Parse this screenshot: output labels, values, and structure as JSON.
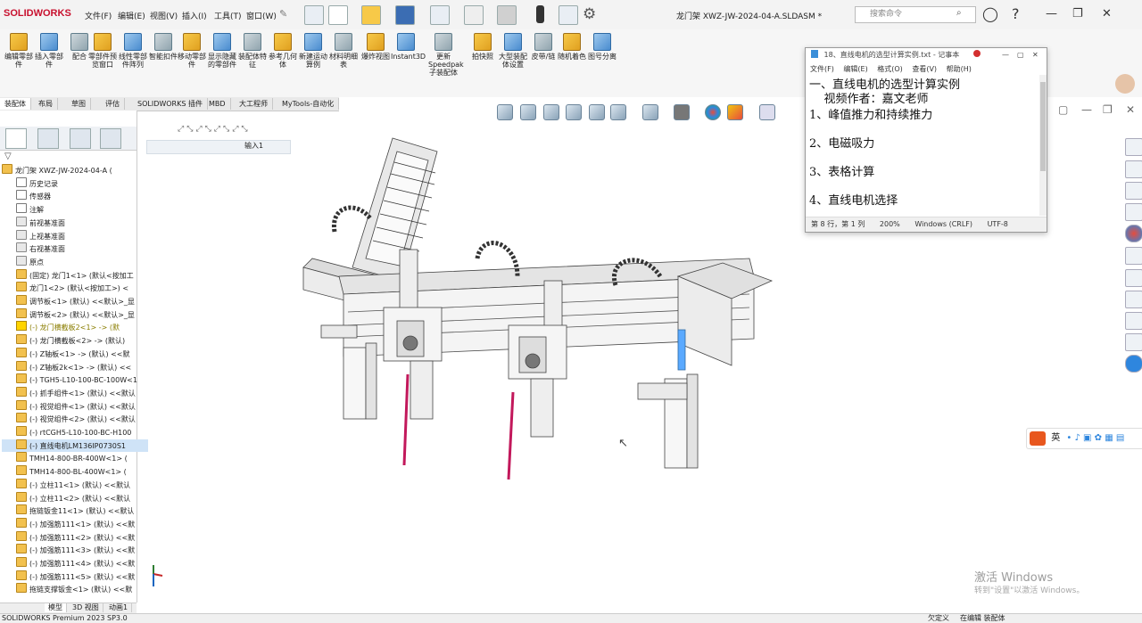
{
  "app": {
    "logo": "SOLIDWORKS",
    "doc_title": "龙门架 XWZ-JW-2024-04-A.SLDASM *",
    "search_placeholder": "搜索命令"
  },
  "menu": [
    "文件(F)",
    "编辑(E)",
    "视图(V)",
    "插入(I)",
    "工具(T)",
    "窗口(W)"
  ],
  "ribbon": [
    {
      "label": "编辑零部件",
      "icon": "edit-component-icon"
    },
    {
      "label": "插入零部件",
      "icon": "insert-component-icon"
    },
    {
      "label": "配合",
      "icon": "mate-icon"
    },
    {
      "label": "零部件预览窗口",
      "icon": "component-preview-icon"
    },
    {
      "label": "线性零部件阵列",
      "icon": "linear-pattern-icon"
    },
    {
      "label": "智能扣件",
      "icon": "smart-fastener-icon"
    },
    {
      "label": "移动零部件",
      "icon": "move-component-icon"
    },
    {
      "label": "显示隐藏的零部件",
      "icon": "show-hidden-icon"
    },
    {
      "label": "装配体特征",
      "icon": "assembly-feature-icon"
    },
    {
      "label": "参考几何体",
      "icon": "reference-geometry-icon"
    },
    {
      "label": "新建运动算例",
      "icon": "motion-study-icon"
    },
    {
      "label": "材料明细表",
      "icon": "bom-icon"
    },
    {
      "label": "爆炸视图",
      "icon": "exploded-view-icon"
    },
    {
      "label": "Instant3D",
      "icon": "instant3d-icon"
    },
    {
      "label": "更新Speedpak子装配体",
      "icon": "speedpak-icon"
    },
    {
      "label": "拍快照",
      "icon": "snapshot-icon"
    },
    {
      "label": "大型装配体设置",
      "icon": "large-assembly-icon"
    },
    {
      "label": "皮带/链",
      "icon": "belt-chain-icon"
    },
    {
      "label": "随机着色",
      "icon": "random-color-icon"
    },
    {
      "label": "图号分离",
      "icon": "drawing-number-icon"
    }
  ],
  "tabs": [
    "装配体",
    "布局",
    "草图",
    "评估",
    "SOLIDWORKS 插件",
    "MBD",
    "大工程师",
    "MyTools-自动化"
  ],
  "breadcrumb_label": "输入1",
  "tree": [
    {
      "label": "龙门架 XWZ-JW-2024-04-A (",
      "type": "asm"
    },
    {
      "label": "历史记录",
      "type": "doc"
    },
    {
      "label": "传感器",
      "type": "doc"
    },
    {
      "label": "注解",
      "type": "doc"
    },
    {
      "label": "前视基准面",
      "type": "pl"
    },
    {
      "label": "上视基准面",
      "type": "pl"
    },
    {
      "label": "右视基准面",
      "type": "pl"
    },
    {
      "label": "原点",
      "type": "pl"
    },
    {
      "label": "(固定) 龙门1<1> (默认<按加工",
      "type": "asm"
    },
    {
      "label": "龙门1<2> (默认<按加工>) <",
      "type": "asm"
    },
    {
      "label": "调节板<1> (默认) <<默认>_显",
      "type": "asm"
    },
    {
      "label": "调节板<2> (默认) <<默认>_显",
      "type": "asm"
    },
    {
      "label": "(-) 龙门横截板2<1> -> (默",
      "type": "warn"
    },
    {
      "label": "(-) 龙门横截板<2> -> (默认)",
      "type": "asm"
    },
    {
      "label": "(-) Z轴板<1> -> (默认) <<默",
      "type": "asm"
    },
    {
      "label": "(-) Z轴板2k<1> -> (默认) <<",
      "type": "asm"
    },
    {
      "label": "(-) TGH5-L10-100-BC-100W<1",
      "type": "asm"
    },
    {
      "label": "(-) 抓手组件<1> (默认) <<默认",
      "type": "asm"
    },
    {
      "label": "(-) 视觉组件<1> (默认) <<默认",
      "type": "asm"
    },
    {
      "label": "(-) 视觉组件<2> (默认) <<默认",
      "type": "asm"
    },
    {
      "label": "(-) rtCGH5-L10-100-BC-H100",
      "type": "asm"
    },
    {
      "label": "(-) 直线电机LM136IP0730S1",
      "type": "sel"
    },
    {
      "label": "TMH14-800-BR-400W<1> (",
      "type": "asm"
    },
    {
      "label": "TMH14-800-BL-400W<1> (",
      "type": "asm"
    },
    {
      "label": "(-) 立柱11<1> (默认) <<默认",
      "type": "asm"
    },
    {
      "label": "(-) 立柱11<2> (默认) <<默认",
      "type": "asm"
    },
    {
      "label": "拖链钣金11<1> (默认) <<默认",
      "type": "asm"
    },
    {
      "label": "(-) 加强筋111<1> (默认) <<默",
      "type": "asm"
    },
    {
      "label": "(-) 加强筋111<2> (默认) <<默",
      "type": "asm"
    },
    {
      "label": "(-) 加强筋111<3> (默认) <<默",
      "type": "asm"
    },
    {
      "label": "(-) 加强筋111<4> (默认) <<默",
      "type": "asm"
    },
    {
      "label": "(-) 加强筋111<5> (默认) <<默",
      "type": "asm"
    },
    {
      "label": "拖链支撑钣金<1> (默认) <<默",
      "type": "asm"
    }
  ],
  "bottom_tabs": [
    "模型",
    "3D 视图",
    "动画1"
  ],
  "status": {
    "left": "SOLIDWORKS Premium 2023 SP3.0",
    "mid1": "欠定义",
    "mid2": "在编辑 装配体"
  },
  "notepad": {
    "title": "18、直线电机的选型计算实例.txt - 记事本",
    "menu": [
      "文件(F)",
      "编辑(E)",
      "格式(O)",
      "查看(V)",
      "帮助(H)"
    ],
    "lines": [
      "一、直线电机的选型计算实例",
      "    视频作者：嘉文老师",
      "1、峰值推力和持续推力",
      "",
      "2、电磁吸力",
      "",
      "3、表格计算",
      "",
      "4、直线电机选择"
    ],
    "status_pos": "第 8 行，第 1 列",
    "status_zoom": "200%",
    "status_eol": "Windows (CRLF)",
    "status_enc": "UTF-8"
  },
  "watermark": {
    "line1": "激活 Windows",
    "line2": "转到\"设置\"以激活 Windows。"
  },
  "ime": {
    "label": "英"
  }
}
